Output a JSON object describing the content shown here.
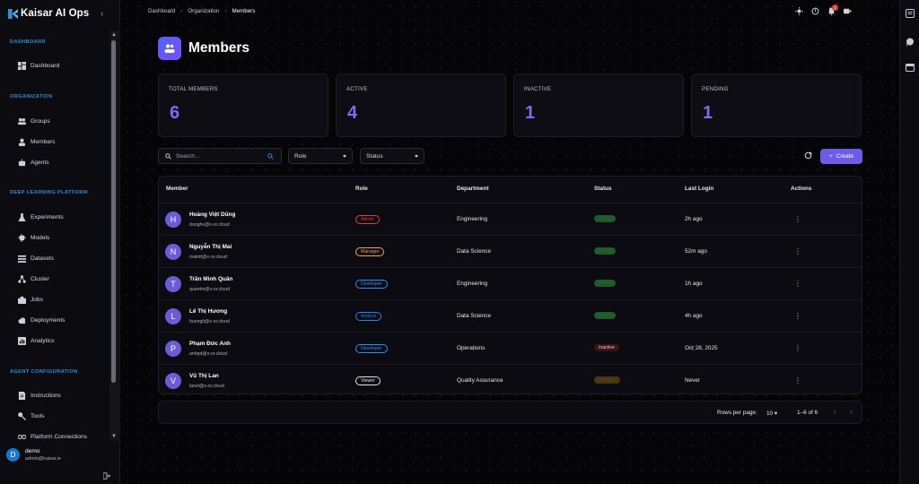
{
  "app": {
    "name": "Kaisar AI Ops"
  },
  "sidebar": {
    "sections": [
      {
        "title": "DASHBOARD",
        "items": [
          {
            "label": "Dashboard",
            "icon": "dashboard-icon"
          }
        ]
      },
      {
        "title": "ORGANIZATION",
        "items": [
          {
            "label": "Groups",
            "icon": "groups-icon"
          },
          {
            "label": "Members",
            "icon": "person-icon"
          },
          {
            "label": "Agents",
            "icon": "robot-icon"
          }
        ]
      },
      {
        "title": "DEEP LEARNING PLATFORM",
        "items": [
          {
            "label": "Experiments",
            "icon": "flask-icon"
          },
          {
            "label": "Models",
            "icon": "chip-icon"
          },
          {
            "label": "Datasets",
            "icon": "list-icon"
          },
          {
            "label": "Cluster",
            "icon": "network-icon"
          },
          {
            "label": "Jobs",
            "icon": "briefcase-icon"
          },
          {
            "label": "Deployments",
            "icon": "cloud-upload-icon"
          },
          {
            "label": "Analytics",
            "icon": "analytics-icon"
          }
        ]
      },
      {
        "title": "AGENT CONFIGURATION",
        "items": [
          {
            "label": "Instructions",
            "icon": "document-icon"
          },
          {
            "label": "Tools",
            "icon": "wrench-icon"
          },
          {
            "label": "Platform Connections",
            "icon": "link-icon"
          }
        ]
      }
    ],
    "user": {
      "initial": "D",
      "name": "demo",
      "email": "admin@kaisar.io"
    }
  },
  "header": {
    "breadcrumb": [
      "Dashboard",
      "Organization",
      "Members"
    ],
    "notifications": "1"
  },
  "page": {
    "title": "Members"
  },
  "stats": [
    {
      "label": "TOTAL MEMBERS",
      "value": "6"
    },
    {
      "label": "ACTIVE",
      "value": "4"
    },
    {
      "label": "INACTIVE",
      "value": "1"
    },
    {
      "label": "PENDING",
      "value": "1"
    }
  ],
  "filters": {
    "search_placeholder": "Search...",
    "role": "Role",
    "status": "Status",
    "create_label": "Create"
  },
  "table": {
    "columns": [
      "Member",
      "Role",
      "Department",
      "Status",
      "Last Login",
      "Actions"
    ],
    "rows": [
      {
        "initial": "H",
        "name": "Hoàng Việt Dũng",
        "email": "dunghv@x-or.cloud",
        "role": "Admin",
        "role_color": "#e53935",
        "department": "Engineering",
        "status": "Active",
        "status_color": "#1e5a2a",
        "last_login": "2h ago"
      },
      {
        "initial": "N",
        "name": "Nguyễn Thị Mai",
        "email": "maintt@x-or.cloud",
        "role": "Manager",
        "role_color": "#f5a623",
        "department": "Data Science",
        "status": "Active",
        "status_color": "#1e5a2a",
        "last_login": "52m ago"
      },
      {
        "initial": "T",
        "name": "Trần Minh Quân",
        "email": "quantm@x-or.cloud",
        "role": "Developer",
        "role_color": "#2196f3",
        "department": "Engineering",
        "status": "Active",
        "status_color": "#1e5a2a",
        "last_login": "1h ago"
      },
      {
        "initial": "L",
        "name": "Lê Thị Hương",
        "email": "huonglt@x-or.cloud",
        "role": "Analyst",
        "role_color": "#1e88e5",
        "department": "Data Science",
        "status": "Active",
        "status_color": "#1e5a2a",
        "last_login": "4h ago"
      },
      {
        "initial": "P",
        "name": "Phạm Đức Anh",
        "email": "anhpd@x-or.cloud",
        "role": "Developer",
        "role_color": "#2196f3",
        "department": "Operations",
        "status": "Inactive",
        "status_color": "#3a1414",
        "last_login": "Oct 28, 2025"
      },
      {
        "initial": "V",
        "name": "Vũ Thị Lan",
        "email": "lanvt@x-or.cloud",
        "role": "Viewer",
        "role_color": "#e0e0e8",
        "department": "Quality Assurance",
        "status": "Pending",
        "status_color": "#4a3610",
        "last_login": "Never"
      }
    ]
  },
  "pagination": {
    "rows_label": "Rows per page:",
    "rows_value": "10",
    "range": "1–6 of 6"
  }
}
